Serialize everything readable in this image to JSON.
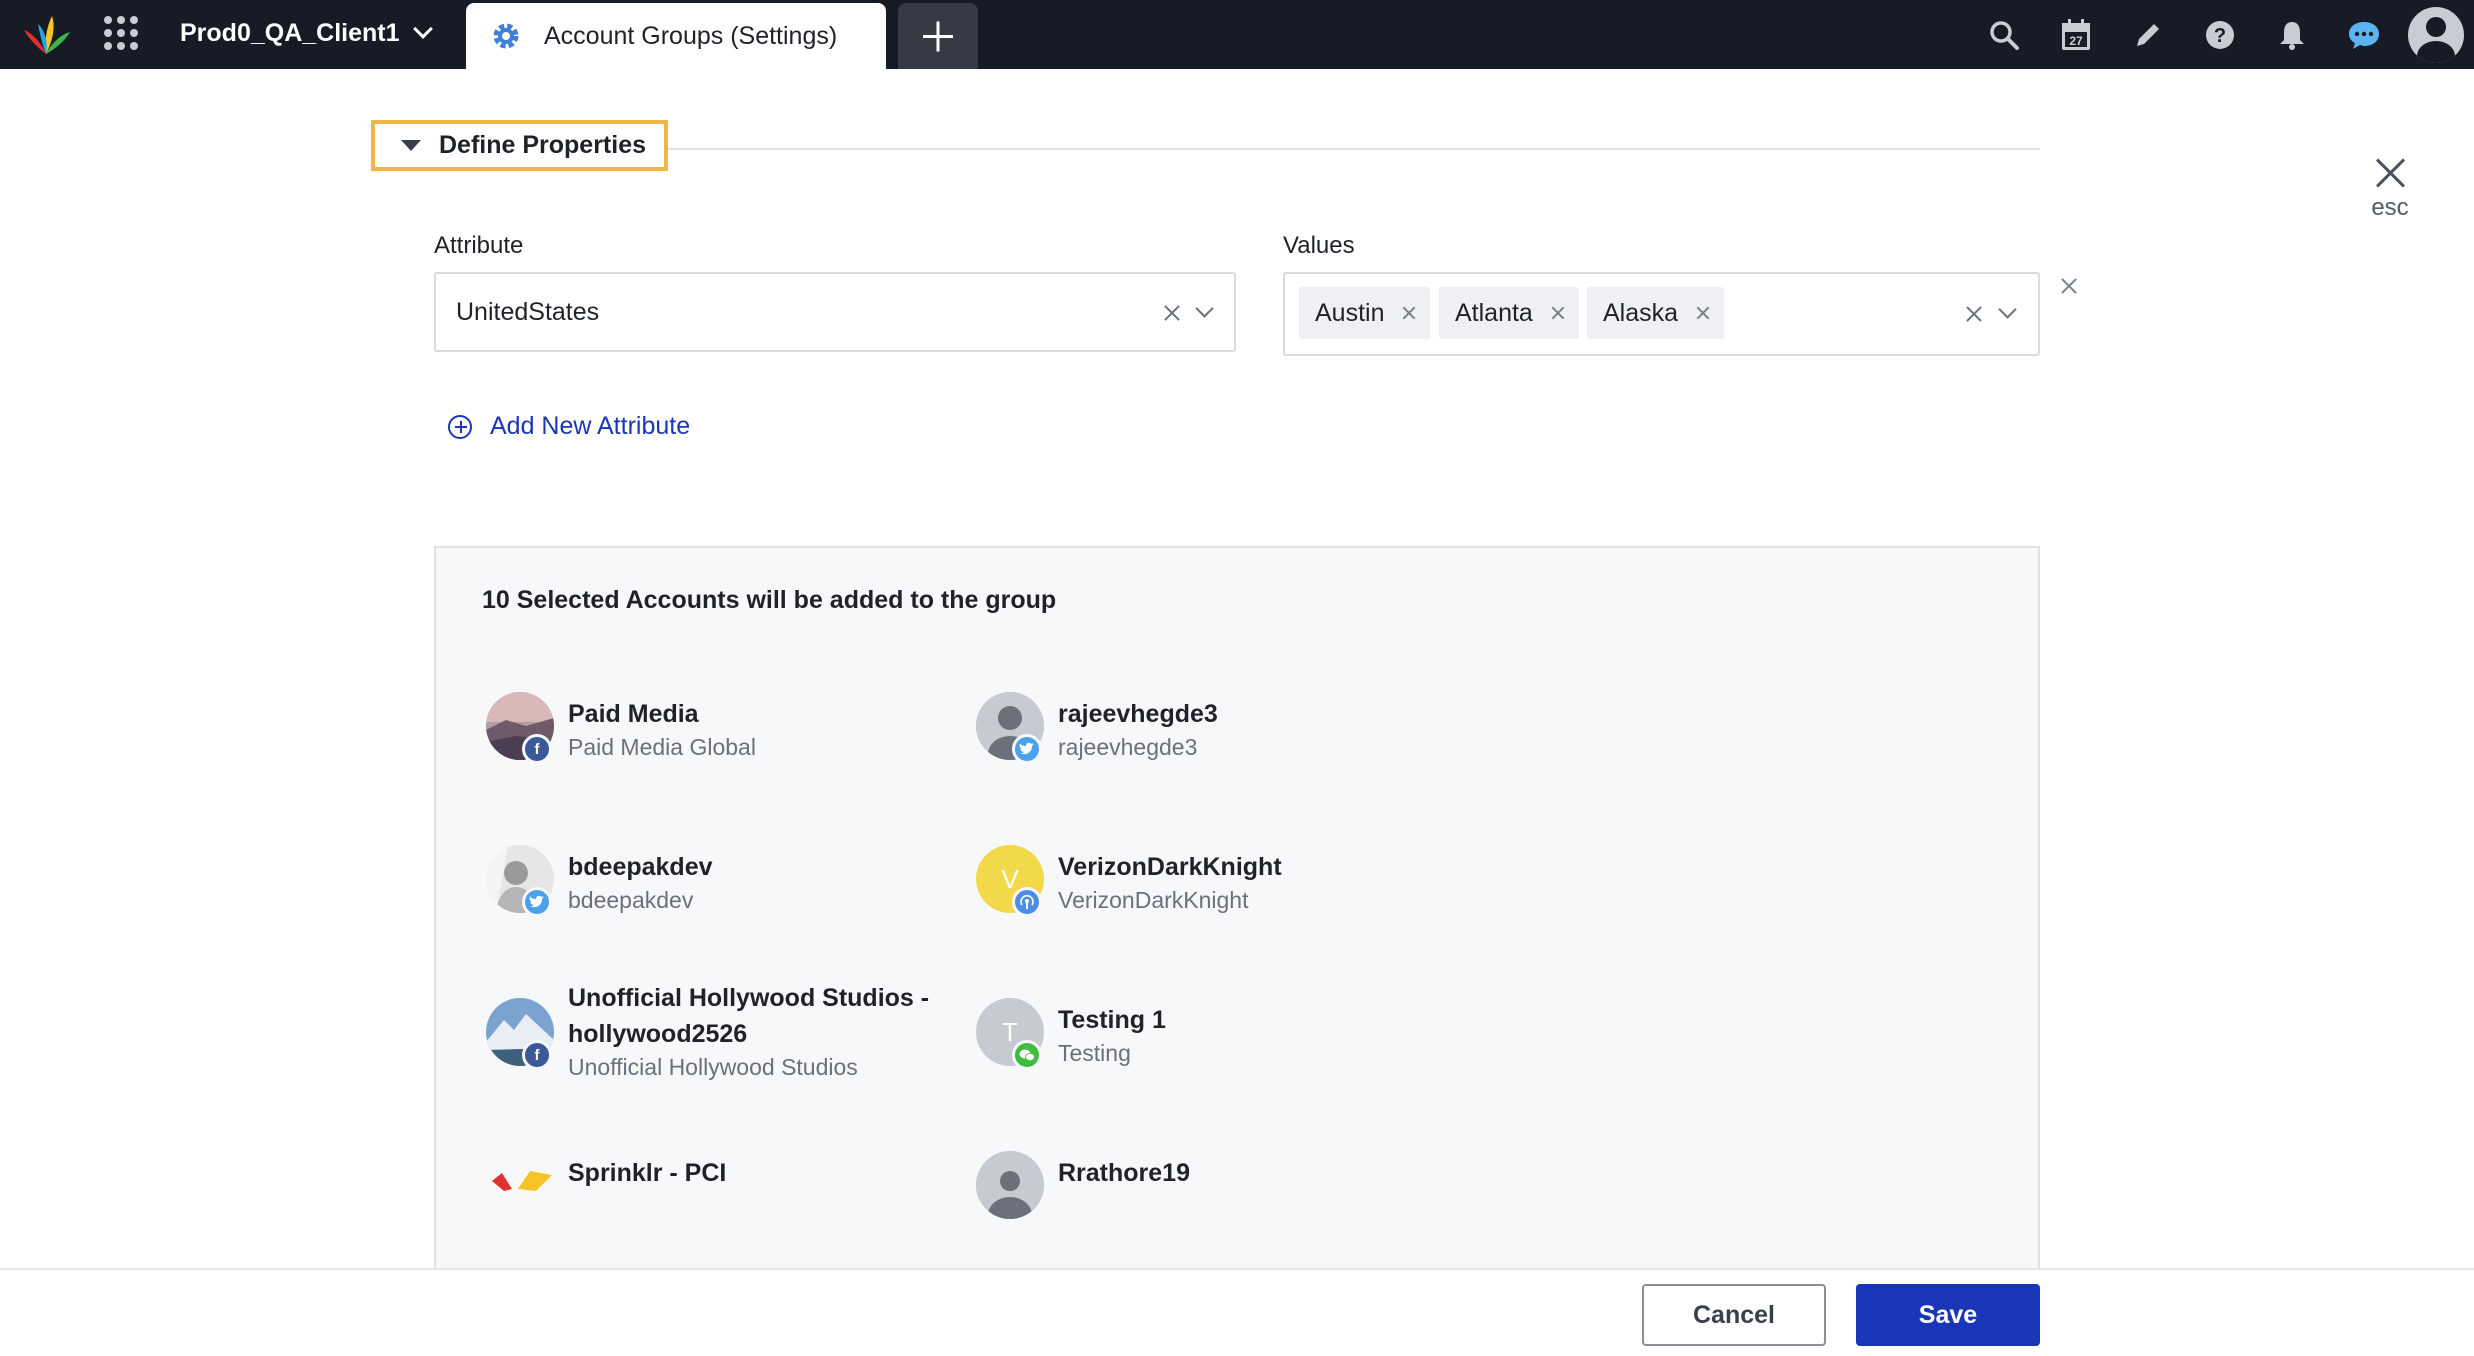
{
  "topbar": {
    "client_name": "Prod0_QA_Client1",
    "active_tab_label": "Account Groups (Settings)",
    "calendar_day": "27",
    "icons": [
      "search-icon",
      "calendar-icon",
      "edit-icon",
      "help-icon",
      "notification-icon",
      "chat-icon",
      "user-avatar"
    ]
  },
  "section": {
    "title": "Define Properties",
    "close_label": "esc"
  },
  "form": {
    "attribute_label": "Attribute",
    "attribute_value": "UnitedStates",
    "values_label": "Values",
    "values": [
      "Austin",
      "Atlanta",
      "Alaska"
    ],
    "add_attribute_label": "Add New Attribute"
  },
  "accounts": {
    "title": "10 Selected Accounts will be added to the group",
    "items": [
      {
        "name": "Paid Media",
        "sub": "Paid Media Global",
        "network": "facebook"
      },
      {
        "name": "rajeevhegde3",
        "sub": "rajeevhegde3",
        "network": "twitter"
      },
      {
        "name": "bdeepakdev",
        "sub": "bdeepakdev",
        "network": "twitter"
      },
      {
        "name": "VerizonDarkKnight",
        "sub": "VerizonDarkKnight",
        "network": "podcast",
        "avatar_letter": "V"
      },
      {
        "name_line1": "Unofficial Hollywood Studios -",
        "name_line2": "hollywood2526",
        "sub": "Unofficial Hollywood Studios",
        "network": "facebook"
      },
      {
        "name": "Testing 1",
        "sub": "Testing",
        "network": "wechat",
        "avatar_letter": "T"
      },
      {
        "name": "Sprinklr - PCI",
        "sub": ""
      },
      {
        "name": "Rrathore19",
        "sub": ""
      }
    ]
  },
  "footer": {
    "cancel_label": "Cancel",
    "save_label": "Save"
  },
  "colors": {
    "topbar_bg": "#161b26",
    "accent_blue": "#1936b8",
    "highlight_border": "#efb64a"
  }
}
